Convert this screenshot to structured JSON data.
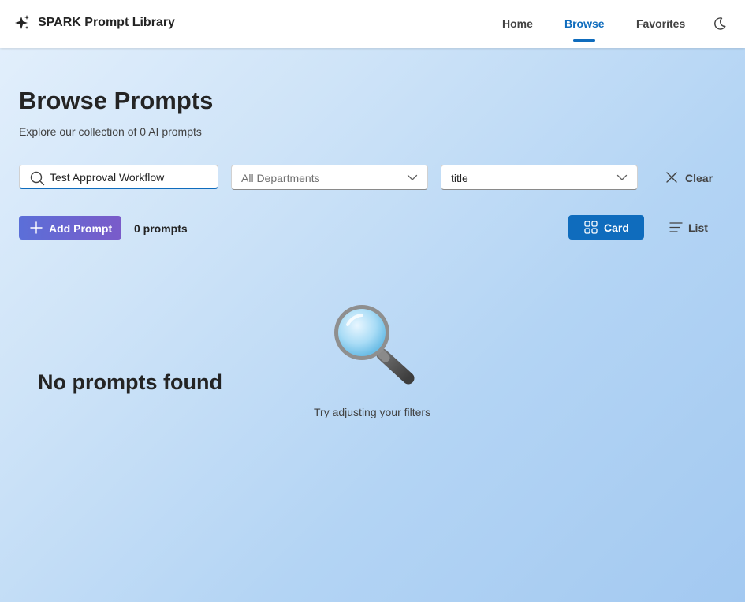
{
  "header": {
    "title": "SPARK Prompt Library",
    "brand_icon": "sparkle-icon",
    "nav": [
      {
        "label": "Home",
        "active": false
      },
      {
        "label": "Browse",
        "active": true
      },
      {
        "label": "Favorites",
        "active": false
      }
    ],
    "theme_toggle_icon": "moon-icon",
    "accent_color": "#0f6cbd"
  },
  "page": {
    "title": "Browse Prompts",
    "subtitle": "Explore our collection of 0 AI prompts"
  },
  "filters": {
    "search": {
      "value": "Test Approval Workflow",
      "icon": "search-icon"
    },
    "department": {
      "value": "All Departments",
      "is_placeholder": true
    },
    "sort": {
      "value": "title"
    },
    "clear_label": "Clear"
  },
  "toolbar": {
    "add_label": "Add Prompt",
    "count_label": "0 prompts",
    "view_card_label": "Card",
    "view_list_label": "List",
    "active_view": "Card"
  },
  "empty_state": {
    "icon": "magnifying-glass-icon",
    "title": "No prompts found",
    "message": "Try adjusting your filters"
  }
}
